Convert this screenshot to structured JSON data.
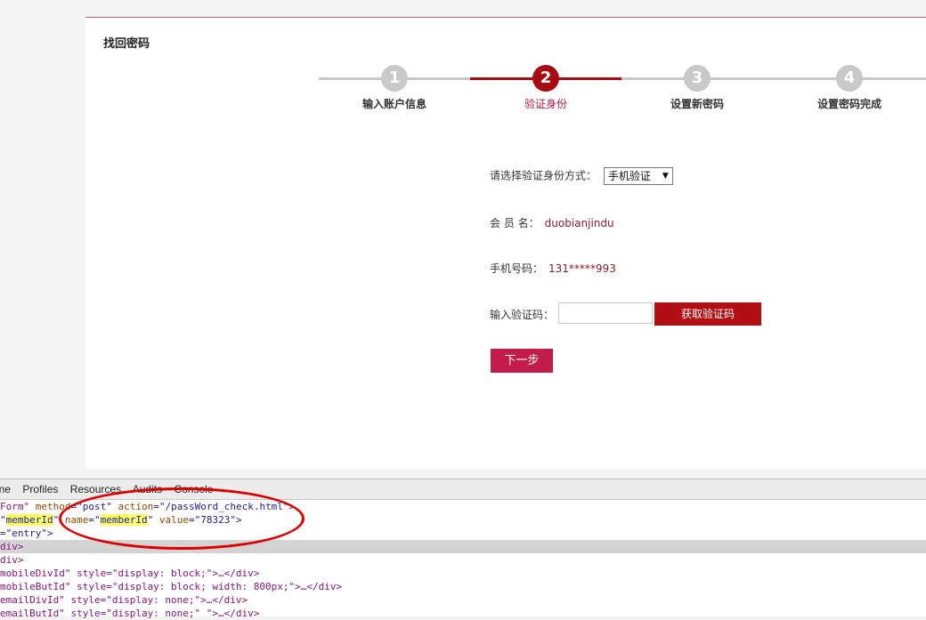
{
  "page": {
    "title": "找回密码"
  },
  "steps": [
    {
      "num": "1",
      "label": "输入账户信息"
    },
    {
      "num": "2",
      "label": "验证身份"
    },
    {
      "num": "3",
      "label": "设置新密码"
    },
    {
      "num": "4",
      "label": "设置密码完成"
    }
  ],
  "form": {
    "verify_method_label": "请选择验证身份方式：",
    "verify_method_value": "手机验证",
    "member_label": "会 员 名：",
    "member_value": "duobianjindu",
    "phone_label": "手机号码：",
    "phone_value": "131*****993",
    "code_label": "输入验证码：",
    "code_value": "",
    "get_code_button": "获取验证码",
    "next_button": "下一步"
  },
  "devtools": {
    "tabs": [
      "ine",
      "Profiles",
      "Resources",
      "Audits",
      "Console"
    ],
    "lines": [
      {
        "t1": "Form\" ",
        "a1": "method",
        "v1": "=\"post\" ",
        "a2": "action",
        "v2": "=\"/passWord_check.html\">"
      },
      {
        "t1": "\"",
        "h1": "memberId",
        "t2": "\" ",
        "a1": "name",
        "t3": "=\"",
        "h2": "memberId",
        "t4": "\" ",
        "a2": "value",
        "v2": "=\"78323\">"
      },
      {
        "text": "=\"entry\">"
      },
      {
        "text": "div>"
      },
      {
        "text": "div>"
      },
      {
        "text": "mobileDivId\" style=\"display: block;\">…</div>"
      },
      {
        "text": "mobileButId\" style=\"display: block; width: 800px;\">…</div>"
      },
      {
        "text": "emailDivId\" style=\"display: none;\">…</div>"
      },
      {
        "text": "emailButId\" style=\"display: none;\" \">…</div>"
      }
    ]
  }
}
